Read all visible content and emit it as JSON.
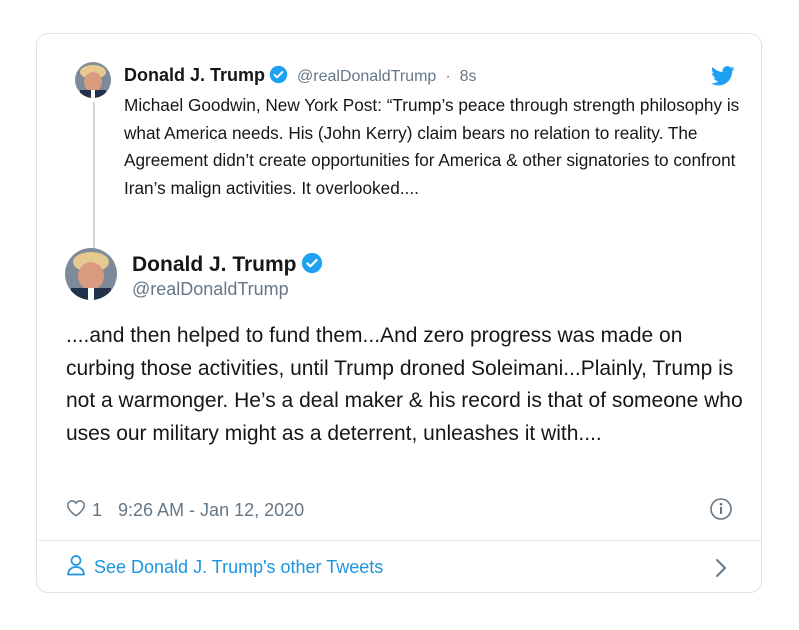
{
  "parent_tweet": {
    "author_name": "Donald J. Trump",
    "handle": "@realDonaldTrump",
    "separator": "·",
    "time": "8s",
    "text": "Michael Goodwin, New York Post: “Trump’s peace through strength philosophy is what America needs. His (John Kerry) claim bears no relation to reality. The Agreement didn’t create opportunities for America & other signatories to confront Iran’s malign activities. It overlooked...."
  },
  "main_tweet": {
    "author_name": "Donald J. Trump",
    "handle": "@realDonaldTrump",
    "text": "....and then helped to fund them...And zero progress was made on curbing those activities, until Trump droned Soleimani...Plainly, Trump is not a warmonger. He’s a deal maker & his record is that of someone who uses our military might as a deterrent, unleashes it with....",
    "likes": "1",
    "timestamp": "9:26 AM - Jan 12, 2020"
  },
  "footer": {
    "link_text": "See Donald J. Trump's other Tweets"
  },
  "colors": {
    "accent": "#1da1f2",
    "link": "#1b95e0",
    "muted": "#657786"
  },
  "icons": [
    "twitter-bird-icon",
    "verified-badge-icon",
    "heart-icon",
    "info-icon",
    "person-icon",
    "chevron-right-icon"
  ]
}
